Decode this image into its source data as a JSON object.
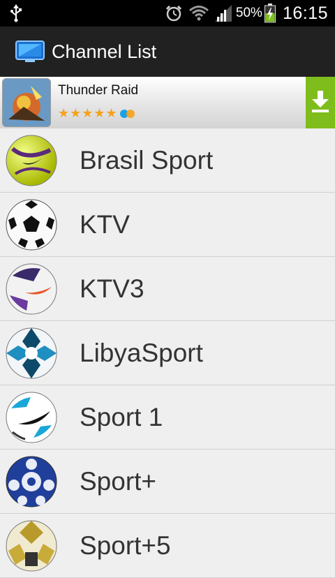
{
  "status_bar": {
    "battery_percent": "50%",
    "time": "16:15",
    "icons": [
      "usb-icon",
      "alarm-icon",
      "wifi-icon",
      "signal-icon",
      "battery-charging-icon"
    ]
  },
  "action_bar": {
    "title": "Channel List",
    "icon": "tv-icon"
  },
  "ad": {
    "title": "Thunder Raid",
    "rating": 4.5,
    "stars": "★★★★★",
    "icon": "download-icon",
    "accent": "#7fbd1c"
  },
  "channels": [
    {
      "name": "Brasil Sport"
    },
    {
      "name": "KTV"
    },
    {
      "name": "KTV3"
    },
    {
      "name": "LibyaSport"
    },
    {
      "name": "Sport 1"
    },
    {
      "name": "Sport+"
    },
    {
      "name": "Sport+5"
    }
  ],
  "colors": {
    "status_bar": "#000000",
    "action_bar": "#212121",
    "list_background": "#efefef",
    "divider": "#d0d0d0"
  }
}
